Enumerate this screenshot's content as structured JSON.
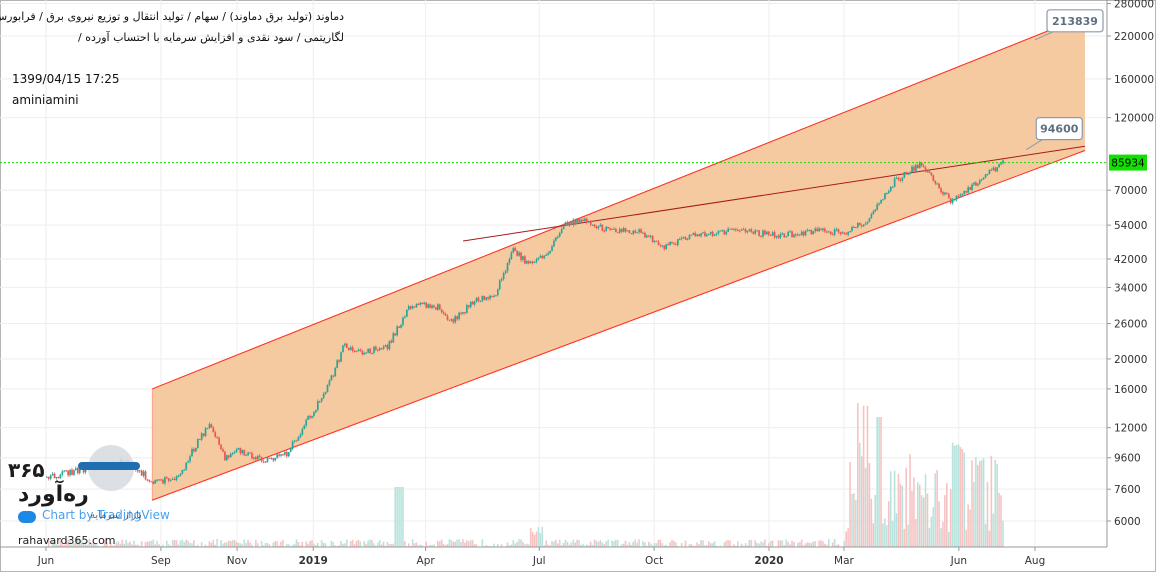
{
  "header": {
    "title_line1": "دماوند (تولید برق دماوند) / سهام / تولید انتقال و توزیع نیروی برق / فرابورس",
    "title_line2": "لگاریتمی / سود نقدی و افزایش سرمایه با احتساب آورده /",
    "datetime": "1399/04/15 17:25",
    "author": "aminiamini"
  },
  "watermark": {
    "brand_digits": "۳۶۵",
    "brand_name": "ره‌آورد",
    "brand_sub": "بازار سرمایه",
    "tradingview": "Chart by TradingView",
    "site": "rahavard365.com"
  },
  "chart_data": {
    "type": "line",
    "scale": "log",
    "ylim": [
      4700,
      290000
    ],
    "y_ticks": [
      6000,
      7600,
      9600,
      12000,
      16000,
      20000,
      26000,
      34000,
      42000,
      54000,
      70000,
      85934,
      120000,
      160000,
      220000,
      280000
    ],
    "y_tick_labels": [
      "6000",
      "7600",
      "9600",
      "12000",
      "16000",
      "20000",
      "26000",
      "34000",
      "42000",
      "54000",
      "70000",
      "85934",
      "120000",
      "160000",
      "220000",
      "280000"
    ],
    "x_tick_labels": [
      "Jun",
      "Sep",
      "Nov",
      "2019",
      "Apr",
      "Jul",
      "Oct",
      "2020",
      "Mar",
      "Jun",
      "Aug"
    ],
    "x_tick_dates": [
      "2018-06-01",
      "2018-09-01",
      "2018-11-01",
      "2019-01-01",
      "2019-04-01",
      "2019-07-01",
      "2019-10-01",
      "2020-01-01",
      "2020-03-01",
      "2020-06-01",
      "2020-08-01"
    ],
    "last_price": 85934,
    "last_price_label": "85934",
    "price_points": [
      {
        "date": "2018-06-01",
        "close": 8300
      },
      {
        "date": "2018-07-10",
        "close": 9000
      },
      {
        "date": "2018-08-05",
        "close": 9300
      },
      {
        "date": "2018-08-25",
        "close": 8000
      },
      {
        "date": "2018-09-15",
        "close": 8300
      },
      {
        "date": "2018-09-28",
        "close": 10500
      },
      {
        "date": "2018-10-10",
        "close": 12500
      },
      {
        "date": "2018-10-22",
        "close": 9500
      },
      {
        "date": "2018-11-01",
        "close": 10200
      },
      {
        "date": "2018-11-20",
        "close": 9400
      },
      {
        "date": "2018-12-10",
        "close": 9800
      },
      {
        "date": "2018-12-28",
        "close": 13000
      },
      {
        "date": "2019-01-10",
        "close": 15500
      },
      {
        "date": "2019-01-25",
        "close": 22000
      },
      {
        "date": "2019-02-10",
        "close": 21000
      },
      {
        "date": "2019-03-01",
        "close": 22000
      },
      {
        "date": "2019-03-20",
        "close": 30000
      },
      {
        "date": "2019-04-10",
        "close": 29500
      },
      {
        "date": "2019-04-20",
        "close": 26000
      },
      {
        "date": "2019-05-10",
        "close": 31000
      },
      {
        "date": "2019-05-25",
        "close": 31500
      },
      {
        "date": "2019-06-10",
        "close": 45000
      },
      {
        "date": "2019-06-20",
        "close": 41000
      },
      {
        "date": "2019-07-05",
        "close": 43000
      },
      {
        "date": "2019-07-20",
        "close": 54000
      },
      {
        "date": "2019-08-05",
        "close": 56000
      },
      {
        "date": "2019-08-25",
        "close": 52000
      },
      {
        "date": "2019-09-20",
        "close": 51000
      },
      {
        "date": "2019-10-10",
        "close": 46000
      },
      {
        "date": "2019-11-01",
        "close": 50000
      },
      {
        "date": "2019-12-01",
        "close": 52000
      },
      {
        "date": "2020-01-10",
        "close": 50000
      },
      {
        "date": "2020-02-10",
        "close": 52000
      },
      {
        "date": "2020-03-01",
        "close": 51000
      },
      {
        "date": "2020-03-20",
        "close": 56000
      },
      {
        "date": "2020-04-10",
        "close": 75000
      },
      {
        "date": "2020-05-01",
        "close": 85000
      },
      {
        "date": "2020-05-15",
        "close": 72000
      },
      {
        "date": "2020-05-25",
        "close": 65000
      },
      {
        "date": "2020-06-10",
        "close": 72000
      },
      {
        "date": "2020-07-06",
        "close": 85934
      }
    ],
    "channel": {
      "lower": [
        {
          "date": "2018-08-25",
          "value": 7000
        },
        {
          "date": "2020-09-10",
          "value": 94000
        }
      ],
      "upper": [
        {
          "date": "2018-08-25",
          "value": 16000
        },
        {
          "date": "2020-09-10",
          "value": 255000
        }
      ]
    },
    "trendline": [
      {
        "date": "2019-05-01",
        "value": 48000
      },
      {
        "date": "2020-09-10",
        "value": 97000
      }
    ],
    "annotations": [
      {
        "text": "213839",
        "date": "2020-08-01",
        "value": 213839
      },
      {
        "text": "94600",
        "date": "2020-07-25",
        "value": 94600
      }
    ],
    "grid": true,
    "colors": {
      "up": "#26a69a",
      "down": "#ef5350",
      "channel_line": "#ff2a1f",
      "channel_fill": "#f5c79c",
      "trend": "#a61b1b",
      "last_price": "#12e000"
    }
  }
}
